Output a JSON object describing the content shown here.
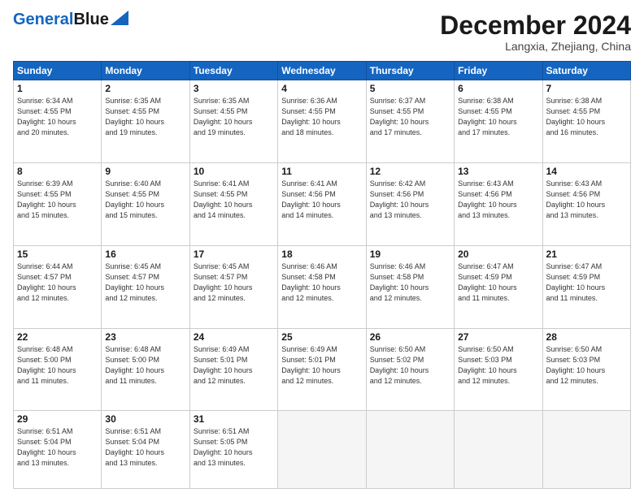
{
  "header": {
    "logo_line1": "General",
    "logo_line2": "Blue",
    "month_title": "December 2024",
    "location": "Langxia, Zhejiang, China"
  },
  "days_of_week": [
    "Sunday",
    "Monday",
    "Tuesday",
    "Wednesday",
    "Thursday",
    "Friday",
    "Saturday"
  ],
  "weeks": [
    [
      {
        "day": "1",
        "info": "Sunrise: 6:34 AM\nSunset: 4:55 PM\nDaylight: 10 hours\nand 20 minutes."
      },
      {
        "day": "2",
        "info": "Sunrise: 6:35 AM\nSunset: 4:55 PM\nDaylight: 10 hours\nand 19 minutes."
      },
      {
        "day": "3",
        "info": "Sunrise: 6:35 AM\nSunset: 4:55 PM\nDaylight: 10 hours\nand 19 minutes."
      },
      {
        "day": "4",
        "info": "Sunrise: 6:36 AM\nSunset: 4:55 PM\nDaylight: 10 hours\nand 18 minutes."
      },
      {
        "day": "5",
        "info": "Sunrise: 6:37 AM\nSunset: 4:55 PM\nDaylight: 10 hours\nand 17 minutes."
      },
      {
        "day": "6",
        "info": "Sunrise: 6:38 AM\nSunset: 4:55 PM\nDaylight: 10 hours\nand 17 minutes."
      },
      {
        "day": "7",
        "info": "Sunrise: 6:38 AM\nSunset: 4:55 PM\nDaylight: 10 hours\nand 16 minutes."
      }
    ],
    [
      {
        "day": "8",
        "info": "Sunrise: 6:39 AM\nSunset: 4:55 PM\nDaylight: 10 hours\nand 15 minutes."
      },
      {
        "day": "9",
        "info": "Sunrise: 6:40 AM\nSunset: 4:55 PM\nDaylight: 10 hours\nand 15 minutes."
      },
      {
        "day": "10",
        "info": "Sunrise: 6:41 AM\nSunset: 4:55 PM\nDaylight: 10 hours\nand 14 minutes."
      },
      {
        "day": "11",
        "info": "Sunrise: 6:41 AM\nSunset: 4:56 PM\nDaylight: 10 hours\nand 14 minutes."
      },
      {
        "day": "12",
        "info": "Sunrise: 6:42 AM\nSunset: 4:56 PM\nDaylight: 10 hours\nand 13 minutes."
      },
      {
        "day": "13",
        "info": "Sunrise: 6:43 AM\nSunset: 4:56 PM\nDaylight: 10 hours\nand 13 minutes."
      },
      {
        "day": "14",
        "info": "Sunrise: 6:43 AM\nSunset: 4:56 PM\nDaylight: 10 hours\nand 13 minutes."
      }
    ],
    [
      {
        "day": "15",
        "info": "Sunrise: 6:44 AM\nSunset: 4:57 PM\nDaylight: 10 hours\nand 12 minutes."
      },
      {
        "day": "16",
        "info": "Sunrise: 6:45 AM\nSunset: 4:57 PM\nDaylight: 10 hours\nand 12 minutes."
      },
      {
        "day": "17",
        "info": "Sunrise: 6:45 AM\nSunset: 4:57 PM\nDaylight: 10 hours\nand 12 minutes."
      },
      {
        "day": "18",
        "info": "Sunrise: 6:46 AM\nSunset: 4:58 PM\nDaylight: 10 hours\nand 12 minutes."
      },
      {
        "day": "19",
        "info": "Sunrise: 6:46 AM\nSunset: 4:58 PM\nDaylight: 10 hours\nand 12 minutes."
      },
      {
        "day": "20",
        "info": "Sunrise: 6:47 AM\nSunset: 4:59 PM\nDaylight: 10 hours\nand 11 minutes."
      },
      {
        "day": "21",
        "info": "Sunrise: 6:47 AM\nSunset: 4:59 PM\nDaylight: 10 hours\nand 11 minutes."
      }
    ],
    [
      {
        "day": "22",
        "info": "Sunrise: 6:48 AM\nSunset: 5:00 PM\nDaylight: 10 hours\nand 11 minutes."
      },
      {
        "day": "23",
        "info": "Sunrise: 6:48 AM\nSunset: 5:00 PM\nDaylight: 10 hours\nand 11 minutes."
      },
      {
        "day": "24",
        "info": "Sunrise: 6:49 AM\nSunset: 5:01 PM\nDaylight: 10 hours\nand 12 minutes."
      },
      {
        "day": "25",
        "info": "Sunrise: 6:49 AM\nSunset: 5:01 PM\nDaylight: 10 hours\nand 12 minutes."
      },
      {
        "day": "26",
        "info": "Sunrise: 6:50 AM\nSunset: 5:02 PM\nDaylight: 10 hours\nand 12 minutes."
      },
      {
        "day": "27",
        "info": "Sunrise: 6:50 AM\nSunset: 5:03 PM\nDaylight: 10 hours\nand 12 minutes."
      },
      {
        "day": "28",
        "info": "Sunrise: 6:50 AM\nSunset: 5:03 PM\nDaylight: 10 hours\nand 12 minutes."
      }
    ],
    [
      {
        "day": "29",
        "info": "Sunrise: 6:51 AM\nSunset: 5:04 PM\nDaylight: 10 hours\nand 13 minutes."
      },
      {
        "day": "30",
        "info": "Sunrise: 6:51 AM\nSunset: 5:04 PM\nDaylight: 10 hours\nand 13 minutes."
      },
      {
        "day": "31",
        "info": "Sunrise: 6:51 AM\nSunset: 5:05 PM\nDaylight: 10 hours\nand 13 minutes."
      },
      {
        "day": "",
        "info": ""
      },
      {
        "day": "",
        "info": ""
      },
      {
        "day": "",
        "info": ""
      },
      {
        "day": "",
        "info": ""
      }
    ]
  ]
}
